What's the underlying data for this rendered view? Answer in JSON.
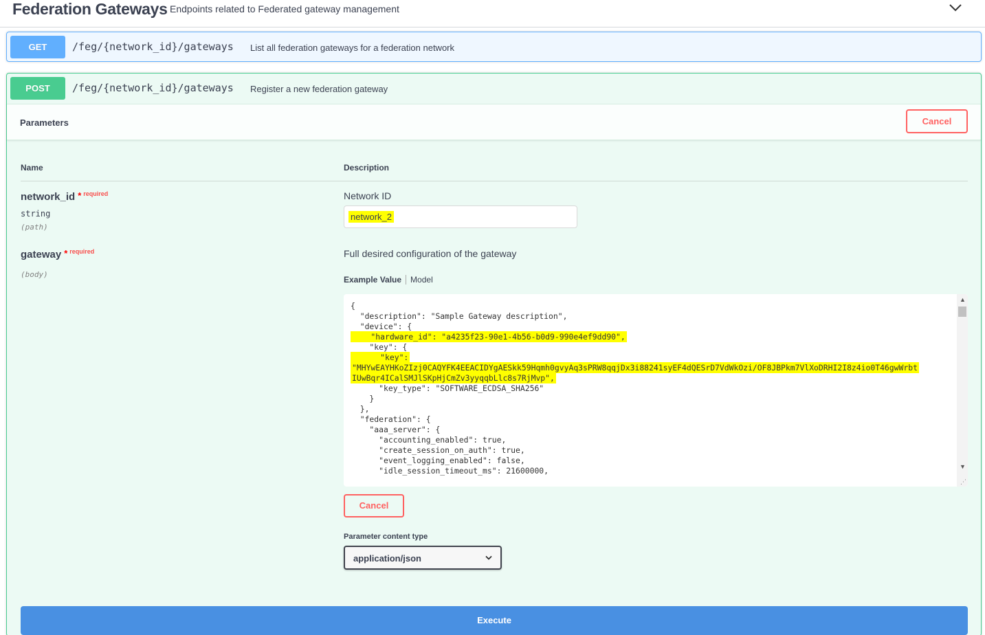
{
  "tag": {
    "title": "Federation Gateways",
    "description": "Endpoints related to Federated gateway management",
    "toggle_icon": "chevron-down-icon"
  },
  "get_op": {
    "method": "GET",
    "path": "/feg/{network_id}/gateways",
    "summary": "List all federation gateways for a federation network"
  },
  "post_op": {
    "method": "POST",
    "path": "/feg/{network_id}/gateways",
    "summary": "Register a new federation gateway",
    "parameters_title": "Parameters",
    "cancel_label": "Cancel",
    "col_name": "Name",
    "col_description": "Description",
    "params": [
      {
        "name": "network_id",
        "required_star": "*",
        "required_label": "required",
        "type": "string",
        "in": "(path)",
        "description": "Network ID",
        "value": "network_2"
      },
      {
        "name": "gateway",
        "required_star": "*",
        "required_label": "required",
        "in": "(body)",
        "description": "Full desired configuration of the gateway"
      }
    ],
    "tabs": {
      "example_value": "Example Value",
      "model": "Model"
    },
    "body_lines": [
      "{",
      "  \"description\": \"Sample Gateway description\",",
      "  \"device\": {",
      "    \"hardware_id\": \"a4235f23-90e1-4b56-b0d9-990e4ef9dd90\",",
      "    \"key\": {",
      "      \"key\":",
      "\"MHYwEAYHKoZIzj0CAQYFK4EEACIDYgAESkk59Hqmh0gvyAq3sPRW8qqjDx3i88241syEF4dQESrD7VdWkOzi/OF8JBPkm7VlXoDRHI2I8z4io0T46gwWrbt",
      "IUwBqr4ICalSMJlSKpHjCmZv3yyqqbLlc8s7RjMvp\",",
      "      \"key_type\": \"SOFTWARE_ECDSA_SHA256\"",
      "    }",
      "  },",
      "  \"federation\": {",
      "    \"aaa_server\": {",
      "      \"accounting_enabled\": true,",
      "      \"create_session_on_auth\": true,",
      "      \"event_logging_enabled\": false,",
      "      \"idle_session_timeout_ms\": 21600000,"
    ],
    "content_type_label": "Parameter content type",
    "content_type_value": "application/json",
    "execute_label": "Execute"
  },
  "colors": {
    "get": "#61affe",
    "post": "#49cc90",
    "cancel": "#ff6060",
    "execute": "#4990e2",
    "highlight": "#ffff00"
  }
}
